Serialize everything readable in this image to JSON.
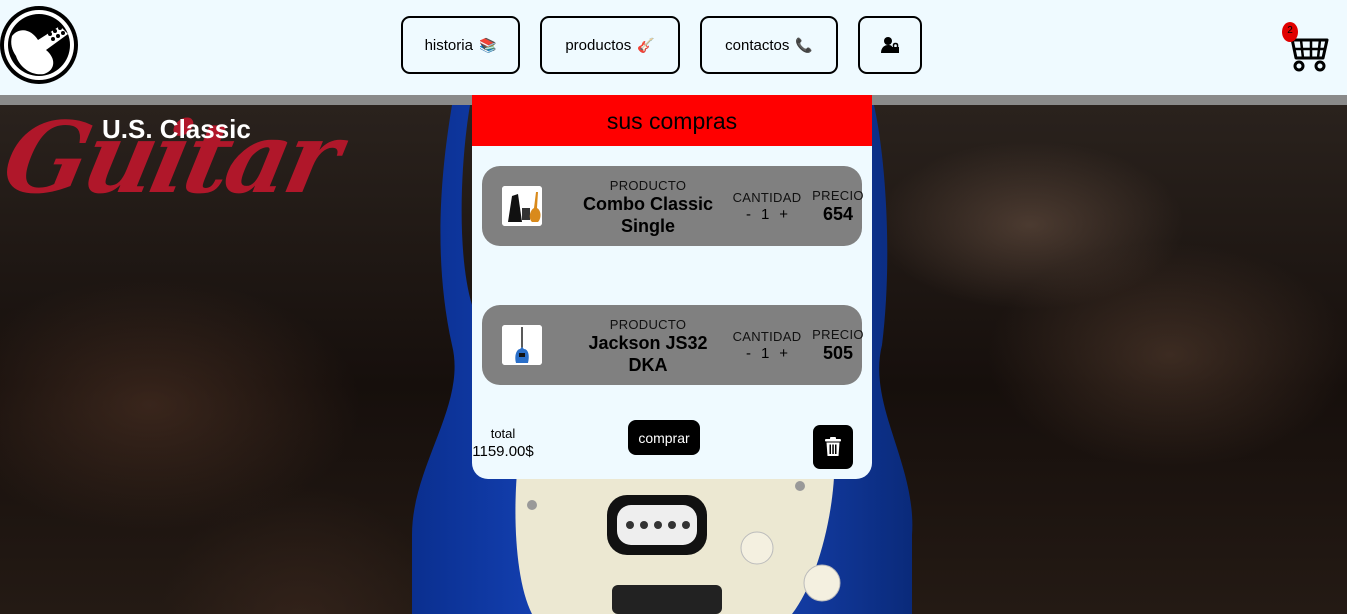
{
  "header": {
    "nav": [
      {
        "label": "historia",
        "icon": "books-icon"
      },
      {
        "label": "productos",
        "icon": "guitar-icon"
      },
      {
        "label": "contactos",
        "icon": "phone-icon"
      }
    ],
    "user_icon": "user-lock-icon",
    "cart_count": "2",
    "colors": {
      "background": "#effaff",
      "badge": "#e00000"
    }
  },
  "brand": {
    "top": "U.S. Classic",
    "script": "Guitar",
    "script_color": "#b0172a"
  },
  "cart_panel": {
    "title": "sus compras",
    "title_bg": "#ff0000",
    "items": [
      {
        "product_label": "PRODUCTO",
        "name": "Combo Classic Single",
        "qty_label": "CANTIDAD",
        "minus": "-",
        "qty": "1",
        "plus": "+",
        "price_label": "PRECIO",
        "price": "654"
      },
      {
        "product_label": "PRODUCTO",
        "name": "Jackson JS32 DKA",
        "qty_label": "CANTIDAD",
        "minus": "-",
        "qty": "1",
        "plus": "+",
        "price_label": "PRECIO",
        "price": "505"
      }
    ],
    "total_label": "total",
    "total_value": "1159.00$",
    "buy_label": "comprar",
    "trash_icon": "trash-icon"
  }
}
